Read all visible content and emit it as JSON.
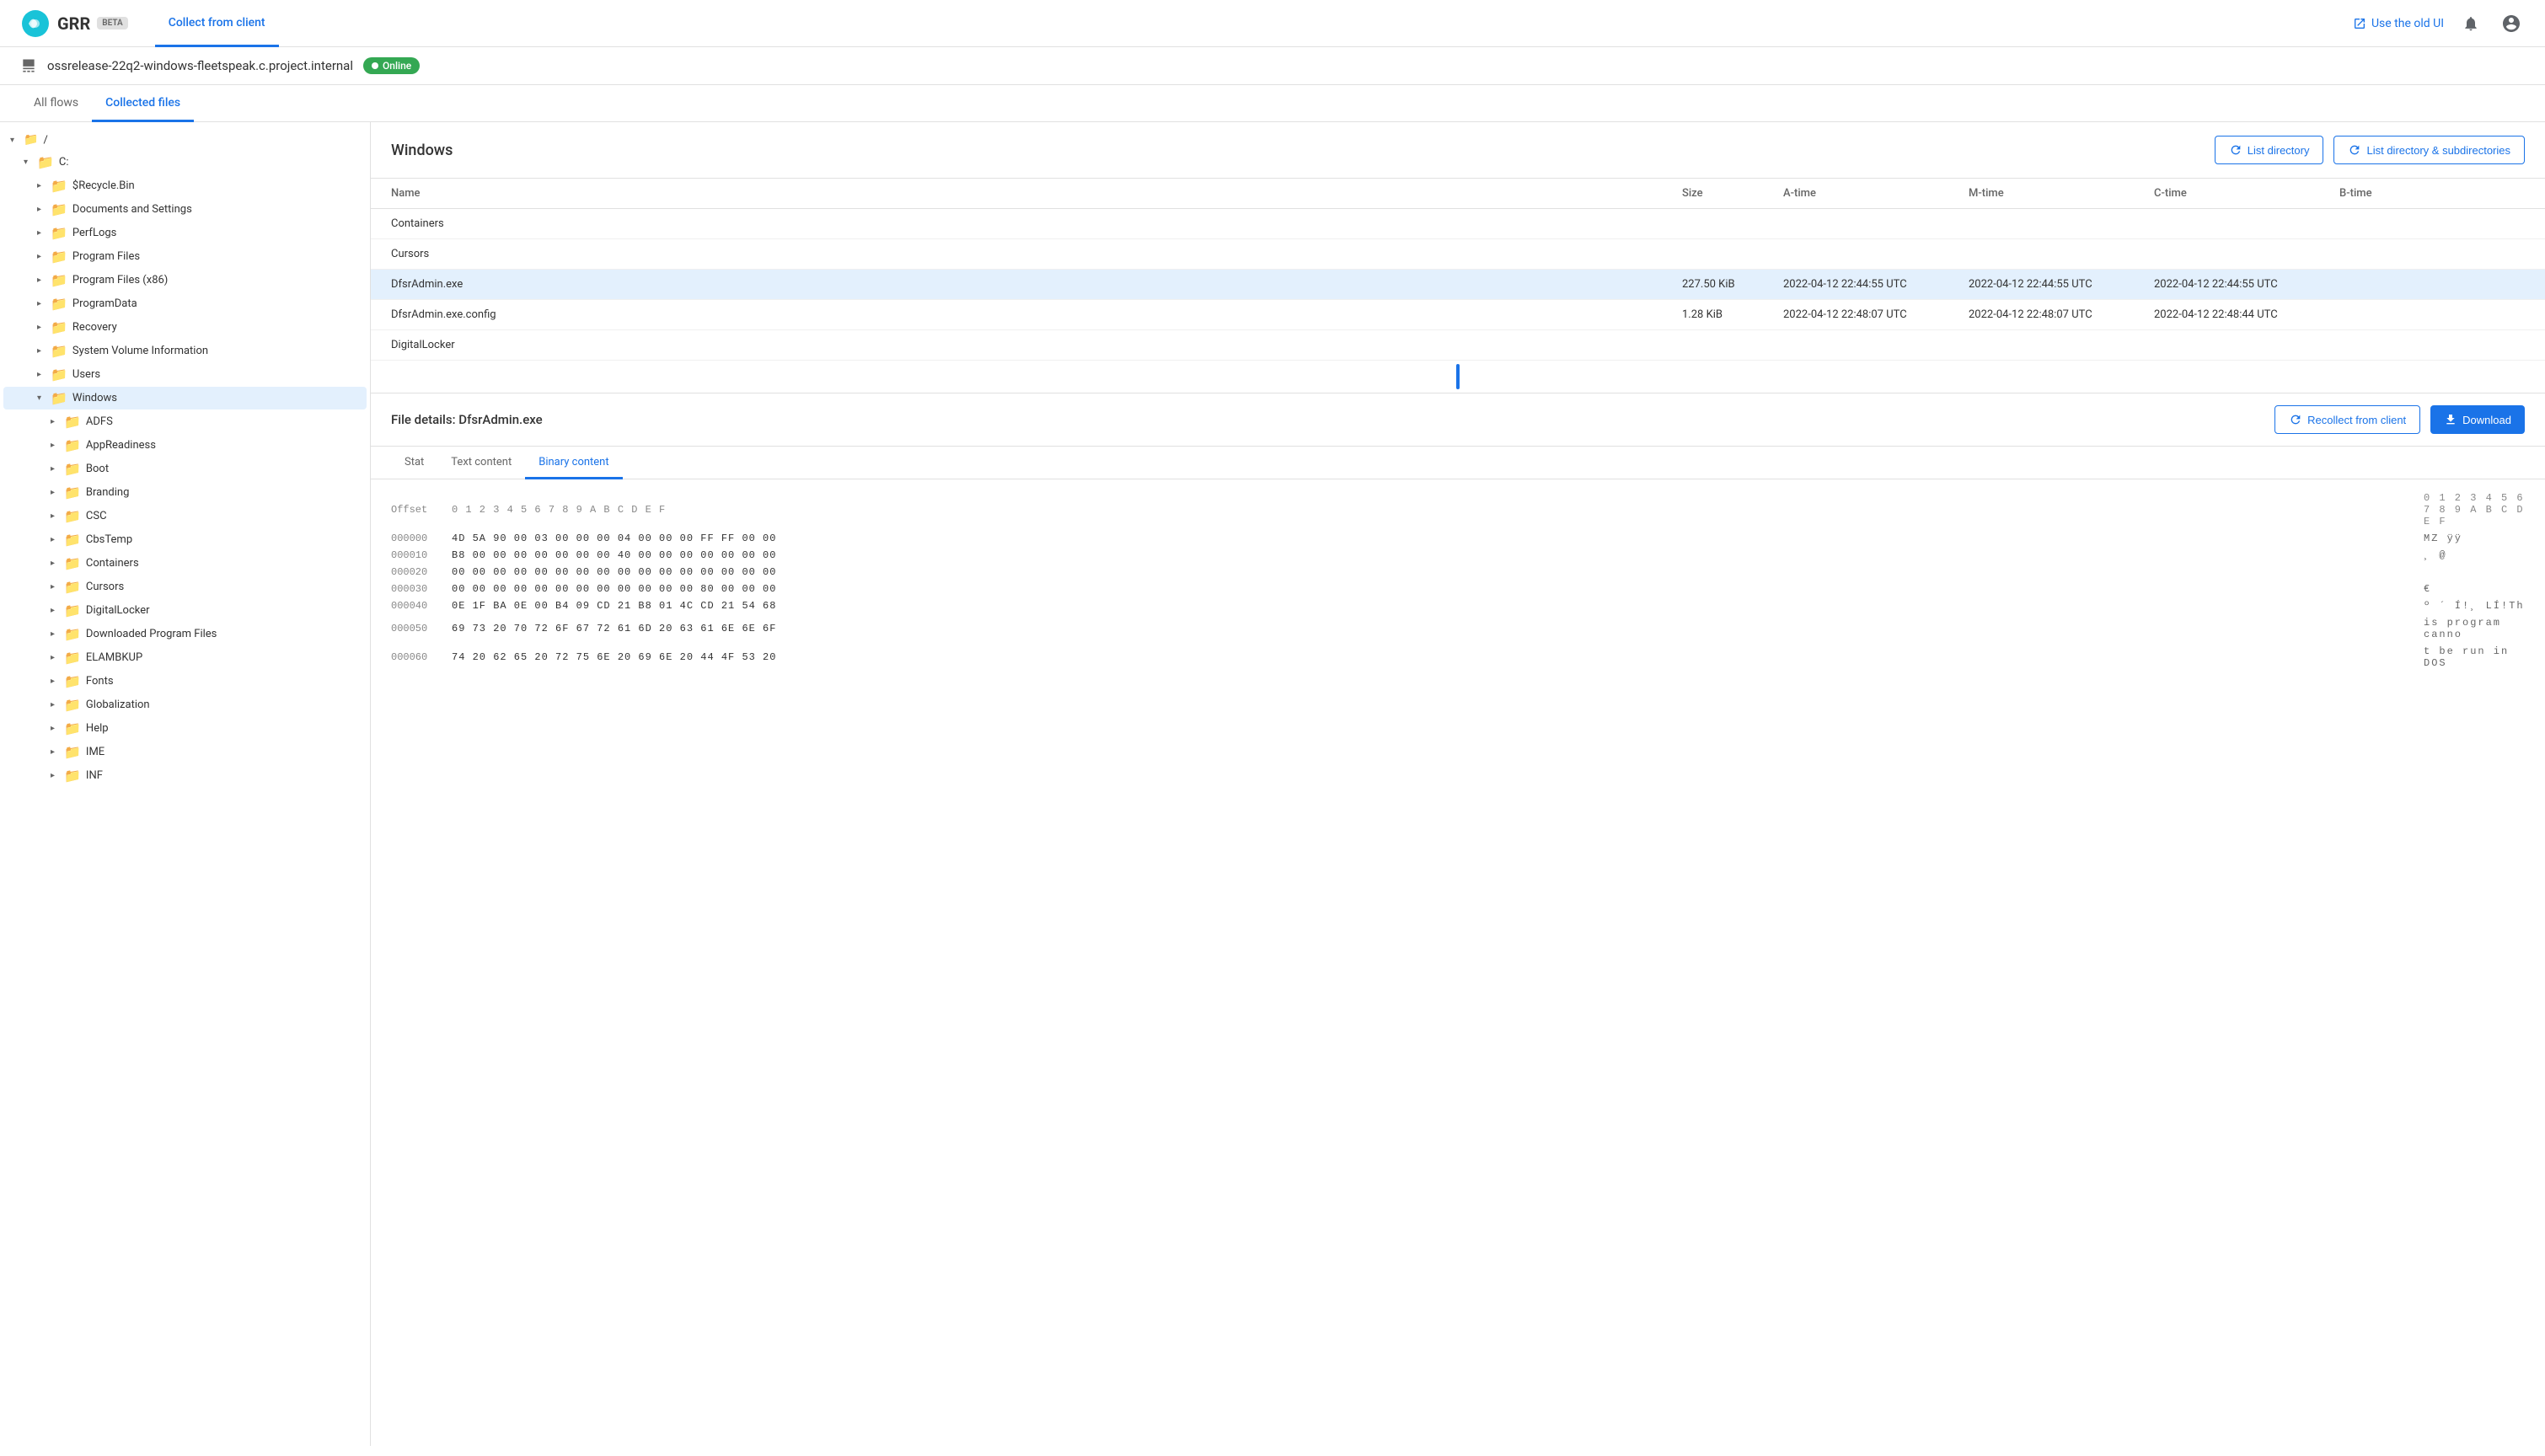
{
  "header": {
    "logo_text": "GRR",
    "beta_label": "BETA",
    "nav_tab": "Collect from client",
    "old_ui_label": "Use the old UI"
  },
  "client": {
    "name": "ossrelease-22q2-windows-fleetspeak.c.project.internal",
    "status": "Online"
  },
  "main_tabs": [
    {
      "label": "All flows",
      "active": false
    },
    {
      "label": "Collected files",
      "active": true
    }
  ],
  "tree": {
    "root_label": "/",
    "items": [
      {
        "label": "/",
        "indent": 0,
        "expanded": true,
        "type": "root"
      },
      {
        "label": "C:",
        "indent": 1,
        "expanded": true,
        "type": "folder"
      },
      {
        "label": "$Recycle.Bin",
        "indent": 2,
        "expanded": false,
        "type": "folder"
      },
      {
        "label": "Documents and Settings",
        "indent": 2,
        "expanded": false,
        "type": "folder"
      },
      {
        "label": "PerfLogs",
        "indent": 2,
        "expanded": false,
        "type": "folder"
      },
      {
        "label": "Program Files",
        "indent": 2,
        "expanded": false,
        "type": "folder"
      },
      {
        "label": "Program Files (x86)",
        "indent": 2,
        "expanded": false,
        "type": "folder"
      },
      {
        "label": "ProgramData",
        "indent": 2,
        "expanded": false,
        "type": "folder"
      },
      {
        "label": "Recovery",
        "indent": 2,
        "expanded": false,
        "type": "folder"
      },
      {
        "label": "System Volume Information",
        "indent": 2,
        "expanded": false,
        "type": "folder"
      },
      {
        "label": "Users",
        "indent": 2,
        "expanded": false,
        "type": "folder"
      },
      {
        "label": "Windows",
        "indent": 2,
        "expanded": true,
        "type": "folder",
        "selected": true
      },
      {
        "label": "ADFS",
        "indent": 3,
        "expanded": false,
        "type": "folder"
      },
      {
        "label": "AppReadiness",
        "indent": 3,
        "expanded": false,
        "type": "folder"
      },
      {
        "label": "Boot",
        "indent": 3,
        "expanded": false,
        "type": "folder"
      },
      {
        "label": "Branding",
        "indent": 3,
        "expanded": false,
        "type": "folder"
      },
      {
        "label": "CSC",
        "indent": 3,
        "expanded": false,
        "type": "folder"
      },
      {
        "label": "CbsTemp",
        "indent": 3,
        "expanded": false,
        "type": "folder"
      },
      {
        "label": "Containers",
        "indent": 3,
        "expanded": false,
        "type": "folder"
      },
      {
        "label": "Cursors",
        "indent": 3,
        "expanded": false,
        "type": "folder"
      },
      {
        "label": "DigitalLocker",
        "indent": 3,
        "expanded": false,
        "type": "folder"
      },
      {
        "label": "Downloaded Program Files",
        "indent": 3,
        "expanded": false,
        "type": "folder"
      },
      {
        "label": "ELAMBKUP",
        "indent": 3,
        "expanded": false,
        "type": "folder"
      },
      {
        "label": "Fonts",
        "indent": 3,
        "expanded": false,
        "type": "folder"
      },
      {
        "label": "Globalization",
        "indent": 3,
        "expanded": false,
        "type": "folder"
      },
      {
        "label": "Help",
        "indent": 3,
        "expanded": false,
        "type": "folder"
      },
      {
        "label": "IME",
        "indent": 3,
        "expanded": false,
        "type": "folder"
      },
      {
        "label": "INF",
        "indent": 3,
        "expanded": false,
        "type": "folder"
      }
    ]
  },
  "directory": {
    "title": "Windows",
    "list_directory_btn": "List directory",
    "list_subdirectories_btn": "List directory & subdirectories",
    "columns": [
      "Name",
      "Size",
      "A-time",
      "M-time",
      "C-time",
      "B-time"
    ],
    "files": [
      {
        "name": "Containers",
        "size": "",
        "atime": "",
        "mtime": "",
        "ctime": "",
        "btime": "",
        "selected": false
      },
      {
        "name": "Cursors",
        "size": "",
        "atime": "",
        "mtime": "",
        "ctime": "",
        "btime": "",
        "selected": false
      },
      {
        "name": "DfsrAdmin.exe",
        "size": "227.50 KiB",
        "atime": "2022-04-12 22:44:55 UTC",
        "mtime": "2022-04-12 22:44:55 UTC",
        "ctime": "2022-04-12 22:44:55 UTC",
        "btime": "",
        "selected": true
      },
      {
        "name": "DfsrAdmin.exe.config",
        "size": "1.28 KiB",
        "atime": "2022-04-12 22:48:07 UTC",
        "mtime": "2022-04-12 22:48:07 UTC",
        "ctime": "2022-04-12 22:48:44 UTC",
        "btime": "",
        "selected": false
      },
      {
        "name": "DigitalLocker",
        "size": "",
        "atime": "",
        "mtime": "",
        "ctime": "",
        "btime": "",
        "selected": false
      }
    ]
  },
  "file_details": {
    "title_prefix": "File details:",
    "filename": "DfsrAdmin.exe",
    "recollect_btn": "Recollect from client",
    "download_btn": "Download",
    "tabs": [
      "Stat",
      "Text content",
      "Binary content"
    ],
    "active_tab": "Binary content",
    "hex_data": [
      {
        "offset": "000000",
        "bytes": "4D 5A 90 00 03 00 00 00 04 00 00 00 FF FF 00 00",
        "ascii": "MZ            ÿÿ  "
      },
      {
        "offset": "000010",
        "bytes": "B8 00 00 00 00 00 00 00 40 00 00 00 00 00 00 00",
        "ascii": "¸       @       "
      },
      {
        "offset": "000020",
        "bytes": "00 00 00 00 00 00 00 00 00 00 00 00 00 00 00 00",
        "ascii": "                "
      },
      {
        "offset": "000030",
        "bytes": "00 00 00 00 00 00 00 00 00 00 00 00 80 00 00 00",
        "ascii": "                €   "
      },
      {
        "offset": "000040",
        "bytes": "0E 1F BA 0E 00 B4 09 CD 21 B8 01 4C CD 21 54 68",
        "ascii": "  º  ´ Í!¸ LÍ!Th"
      },
      {
        "offset": "000050",
        "bytes": "69 73 20 70 72 6F 67 72 61 6D 20 63 61 6E 6E 6F",
        "ascii": "is program canno"
      },
      {
        "offset": "000060",
        "bytes": "74 20 62 65 20 72 75 6E 20 69 6E 20 44 4F 53 20",
        "ascii": "t be run in DOS "
      }
    ]
  },
  "icons": {
    "arrow_right": "▶",
    "arrow_down": "▼",
    "folder": "📁",
    "refresh": "↻",
    "download": "⬇",
    "external_link": "↗",
    "notification": "🔔",
    "account": "👤",
    "monitor": "🖥"
  }
}
